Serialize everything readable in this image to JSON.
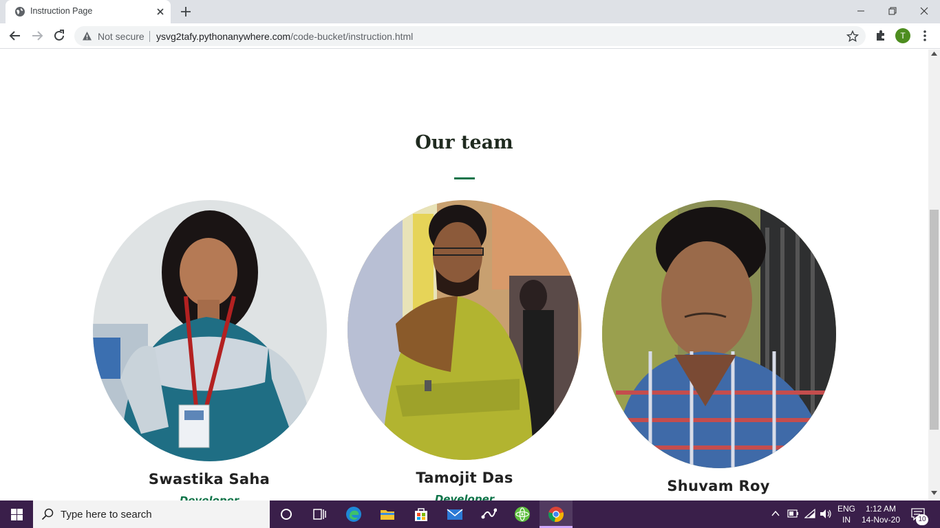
{
  "browser": {
    "tab_title": "Instruction Page",
    "security_label": "Not secure",
    "url_host": "ysvg2tafy.pythonanywhere.com",
    "url_path": "/code-bucket/instruction.html",
    "profile_initial": "T"
  },
  "page": {
    "section_title": "Our team",
    "accent_color": "#0e7449",
    "members": [
      {
        "name": "Swastika Saha",
        "role": "Developer"
      },
      {
        "name": "Tamojit Das",
        "role": "Developer"
      },
      {
        "name": "Shuvam Roy",
        "role": ""
      }
    ]
  },
  "taskbar": {
    "search_placeholder": "Type here to search",
    "apps": [
      "cortana-icon",
      "task-view-icon",
      "edge-icon",
      "file-explorer-icon",
      "store-icon",
      "mail-icon",
      "vs-code-icon",
      "atom-icon",
      "chrome-icon"
    ],
    "language": "ENG",
    "region": "IN",
    "time": "1:12 AM",
    "date": "14-Nov-20",
    "notification_count": "10"
  }
}
